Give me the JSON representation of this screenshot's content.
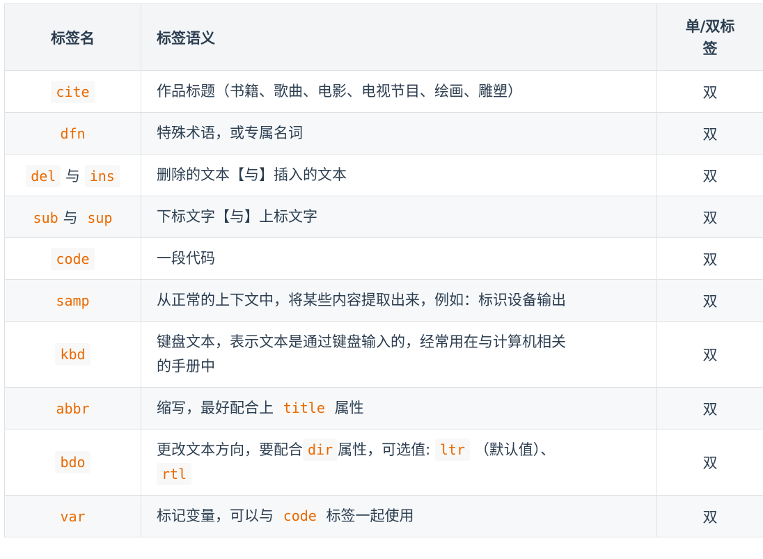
{
  "headers": {
    "tag_name": "标签名",
    "semantics": "标签语义",
    "single_double_line1": "单/双标",
    "single_double_line2": "签"
  },
  "rows": [
    {
      "tag_a": "cite",
      "semantics": "作品标题（书籍、歌曲、电影、电视节目、绘画、雕塑）",
      "kind": "双"
    },
    {
      "tag_a": "dfn",
      "semantics": "特殊术语，或专属名词",
      "kind": "双"
    },
    {
      "tag_a": "del",
      "joiner": "与",
      "tag_b": "ins",
      "semantics": "删除的文本【与】插入的文本",
      "kind": "双"
    },
    {
      "tag_a": "sub",
      "joiner": "与",
      "tag_b": "sup",
      "semantics": "下标文字【与】上标文字",
      "kind": "双"
    },
    {
      "tag_a": "code",
      "semantics": "一段代码",
      "kind": "双"
    },
    {
      "tag_a": "samp",
      "semantics": "从正常的上下文中，将某些内容提取出来，例如：标识设备输出",
      "kind": "双"
    },
    {
      "tag_a": "kbd",
      "semantics_line1": "键盘文本，表示文本是通过键盘输入的，经常用在与计算机相关",
      "semantics_line2": "的手册中",
      "kind": "双"
    },
    {
      "tag_a": "abbr",
      "semantics_pre": "缩写，最好配合上",
      "semantics_code": "title",
      "semantics_post": "属性",
      "kind": "双"
    },
    {
      "tag_a": "bdo",
      "semantics_pre": "更改文本方向，要配合",
      "semantics_code1": "dir",
      "semantics_mid": "属性，可选值:",
      "semantics_code2": "ltr",
      "semantics_mid2": "（默认值）、",
      "semantics_code3": "rtl",
      "kind": "双"
    },
    {
      "tag_a": "var",
      "semantics_pre": "标记变量，可以与",
      "semantics_code": "code",
      "semantics_post": "标签一起使用",
      "kind": "双"
    }
  ]
}
